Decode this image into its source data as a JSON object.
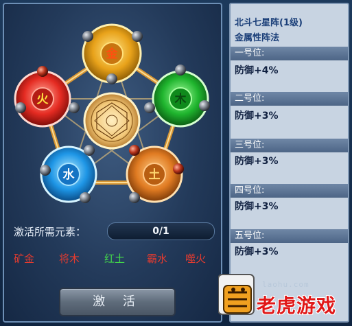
{
  "formation": {
    "title": "北斗七星阵(1级)",
    "subtitle": "金属性阵法",
    "positions": [
      {
        "label": "一号位:",
        "value": "防御+4%"
      },
      {
        "label": "二号位:",
        "value": "防御+3%"
      },
      {
        "label": "三号位:",
        "value": "防御+3%"
      },
      {
        "label": "四号位:",
        "value": "防御+3%"
      },
      {
        "label": "五号位:",
        "value": "防御+3%"
      }
    ]
  },
  "circles": [
    {
      "char": "金",
      "color": "#f0b020",
      "icon": "metal-circle"
    },
    {
      "char": "木",
      "color": "#27c037",
      "icon": "wood-circle"
    },
    {
      "char": "土",
      "color": "#e7862a",
      "icon": "earth-circle"
    },
    {
      "char": "水",
      "color": "#2aa6ee",
      "icon": "water-circle"
    },
    {
      "char": "火",
      "color": "#e9342d",
      "icon": "fire-circle"
    }
  ],
  "requirement": {
    "label": "激活所需元素：",
    "value": "0/1"
  },
  "elements": [
    {
      "text": "矿金",
      "color": "#e53b2f"
    },
    {
      "text": "将木",
      "color": "#e53b2f"
    },
    {
      "text": "红土",
      "color": "#43d84a"
    },
    {
      "text": "霸水",
      "color": "#e53b2f"
    },
    {
      "text": "噬火",
      "color": "#e53b2f"
    }
  ],
  "activate_button": "激 活",
  "watermark": {
    "url": "laohu.com",
    "name": "老虎游戏"
  }
}
